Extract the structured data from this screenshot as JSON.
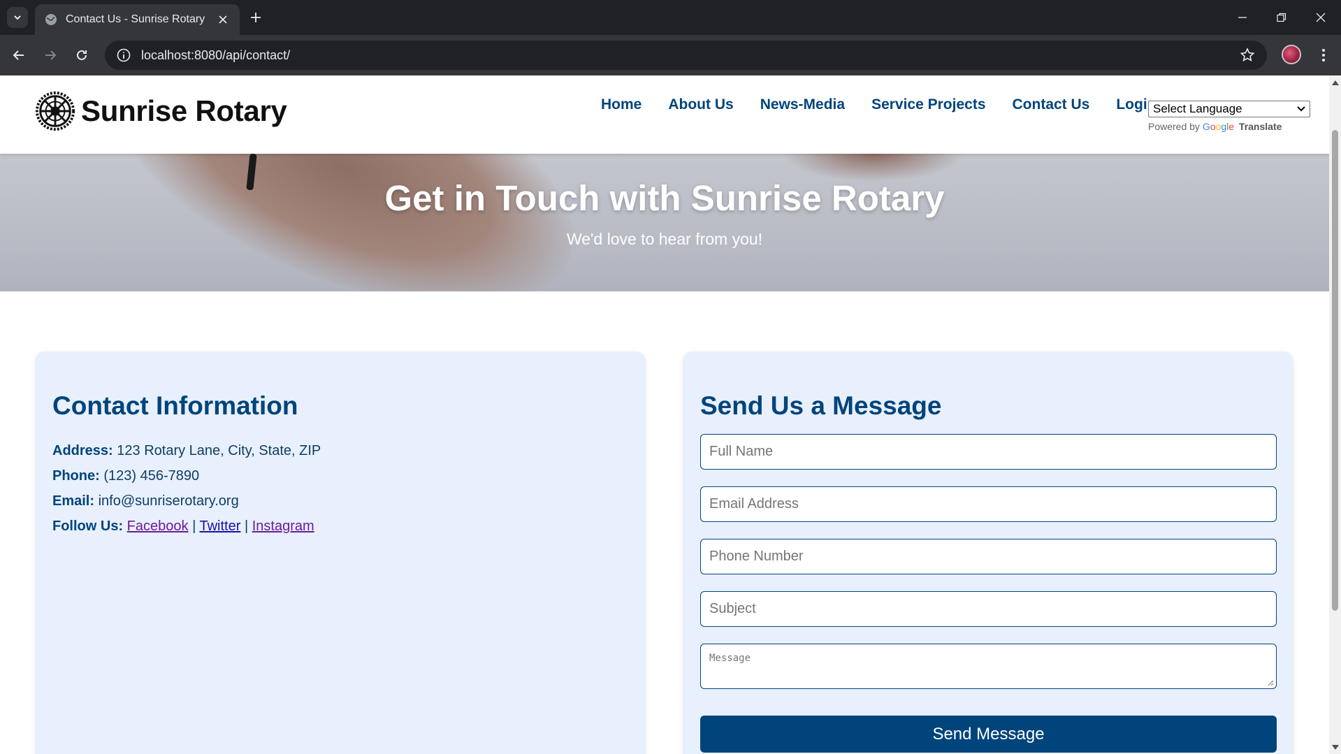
{
  "browser": {
    "tab_title": "Contact Us - Sunrise Rotary",
    "url": "localhost:8080/api/contact/"
  },
  "site": {
    "name": "Sunrise Rotary",
    "nav": [
      "Home",
      "About Us",
      "News-Media",
      "Service Projects",
      "Contact Us",
      "Login"
    ],
    "translate": {
      "select_label": "Select Language",
      "powered_by": "Powered by",
      "google": "Google",
      "translate": "Translate"
    }
  },
  "hero": {
    "title": "Get in Touch with Sunrise Rotary",
    "subtitle": "We'd love to hear from you!"
  },
  "contact_info": {
    "heading": "Contact Information",
    "address_label": "Address:",
    "address": "123 Rotary Lane, City, State, ZIP",
    "phone_label": "Phone:",
    "phone": "(123) 456-7890",
    "email_label": "Email:",
    "email": "info@sunriserotary.org",
    "follow_label": "Follow Us:",
    "social": [
      "Facebook",
      "Twitter",
      "Instagram"
    ],
    "separator": "|"
  },
  "form": {
    "heading": "Send Us a Message",
    "full_name_placeholder": "Full Name",
    "email_placeholder": "Email Address",
    "phone_placeholder": "Phone Number",
    "subject_placeholder": "Subject",
    "message_placeholder": "Message",
    "submit_label": "Send Message"
  },
  "colors": {
    "brand": "#00447c",
    "card_bg": "#e8f0fd",
    "chrome_dark": "#202124",
    "chrome_toolbar": "#35363a"
  }
}
